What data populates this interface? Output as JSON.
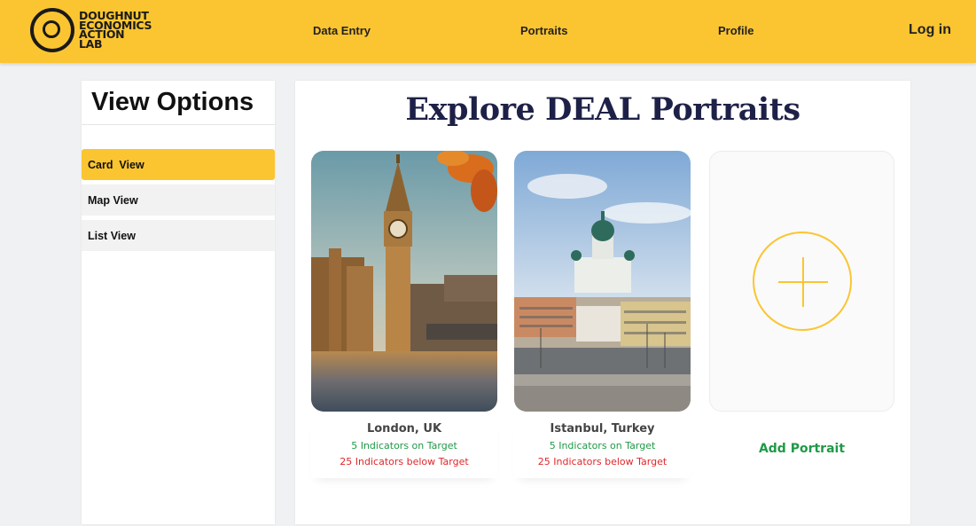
{
  "header": {
    "logo_lines": [
      "DOUGHNUT",
      "ECONOMICS",
      "ACTION",
      "LAB"
    ],
    "nav": [
      "Data Entry",
      "Portraits",
      "Profile"
    ],
    "login": "Log in",
    "accent_color": "#fbc531"
  },
  "sidebar": {
    "title": "View Options",
    "items": [
      {
        "label": "Card  View",
        "active": true
      },
      {
        "label": "Map View",
        "active": false
      },
      {
        "label": "List View",
        "active": false
      }
    ]
  },
  "main": {
    "title": "Explore DEAL Portraits",
    "cards": [
      {
        "name": "London, UK",
        "on_target": "5 Indicators on Target",
        "below_target": "25 Indicators below Target",
        "image": "big-ben-photo"
      },
      {
        "name": "Istanbul, Turkey",
        "on_target": "5 Indicators on Target",
        "below_target": "25 Indicators below Target",
        "image": "helsinki-cathedral-photo"
      }
    ],
    "add_label": "Add Portrait",
    "colors": {
      "on_target": "#1f9a47",
      "below_target": "#e0262b",
      "title": "#1e2147"
    }
  }
}
